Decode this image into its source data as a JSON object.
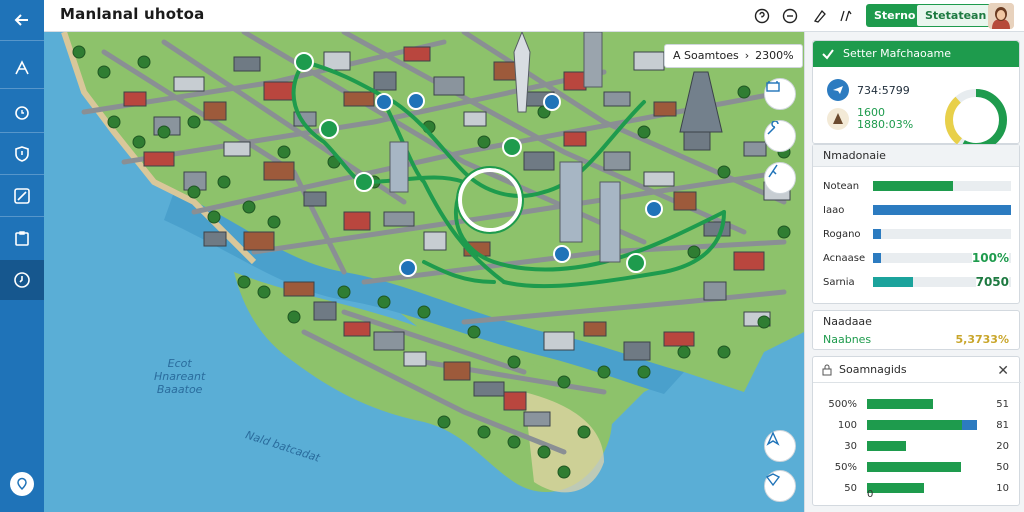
{
  "app": {
    "title": "Manlanal uhotoa"
  },
  "toolbar": {
    "icons": [
      "help-circle-icon",
      "clock-icon",
      "pen-icon",
      "layers-icon"
    ],
    "primary_label": "Sterno",
    "secondary_label": "Stetatean"
  },
  "rail": {
    "icons": [
      "back-arrow-icon",
      "route-icon",
      "alarm-icon",
      "shield-icon",
      "compass-icon",
      "clipboard-icon",
      "timer-icon",
      "location-icon"
    ]
  },
  "map": {
    "scale_label": "A Soamtoes",
    "scale_value": "2300%",
    "water_label_1": "Ecot\nHnareant\nBaaatoe",
    "water_label_2": "Nald batcadat",
    "controls_right": [
      "frame-icon",
      "wrench-icon",
      "pin-icon"
    ],
    "controls_bottom": [
      "north-arrow-icon",
      "locate-icon"
    ]
  },
  "panel": {
    "header": "Setter Mafchaoame",
    "stats": [
      {
        "icon": "plane-icon",
        "value": "734:5799",
        "color": "#2c7bc0"
      },
      {
        "icon": "tree-icon",
        "value": "1600\n1880:03%",
        "color": "#1e9b4d"
      }
    ],
    "donut": {
      "green_fraction": 0.58,
      "yellow_fraction": 0.28
    },
    "section_title": "Nmadonaie",
    "bars": [
      {
        "label": "Notean",
        "fraction": 0.58,
        "color": "#1e9b4d",
        "value": ""
      },
      {
        "label": "Iaao",
        "fraction": 1.0,
        "color": "#2c7bc0",
        "value": ""
      },
      {
        "label": "Rogano",
        "fraction": 0.06,
        "color": "#2c7bc0",
        "value": ""
      },
      {
        "label": "Acnaase",
        "fraction": 0.06,
        "color": "#2c7bc0",
        "value": "100%"
      },
      {
        "label": "Sarnia",
        "fraction": 0.29,
        "color": "#1ba39c",
        "value": "7050"
      }
    ],
    "summary": {
      "label1": "Naadaae",
      "label2": "Naabnes",
      "value": "5,3733%"
    },
    "segments_title": "Soamnagids",
    "segments": [
      {
        "label": "500%",
        "fraction": 0.6,
        "color": "#1e9b4d",
        "value": "51"
      },
      {
        "label": "100",
        "fraction": 1.0,
        "color": "#1e9b4d",
        "accent": "#2c7bc0",
        "value": "81"
      },
      {
        "label": "30",
        "fraction": 0.35,
        "color": "#1e9b4d",
        "value": "20"
      },
      {
        "label": "50%",
        "fraction": 0.85,
        "color": "#1e9b4d",
        "value": "50"
      },
      {
        "label": "50",
        "fraction": 0.52,
        "color": "#1e9b4d",
        "value": "10"
      }
    ],
    "segments_footer": "0"
  }
}
